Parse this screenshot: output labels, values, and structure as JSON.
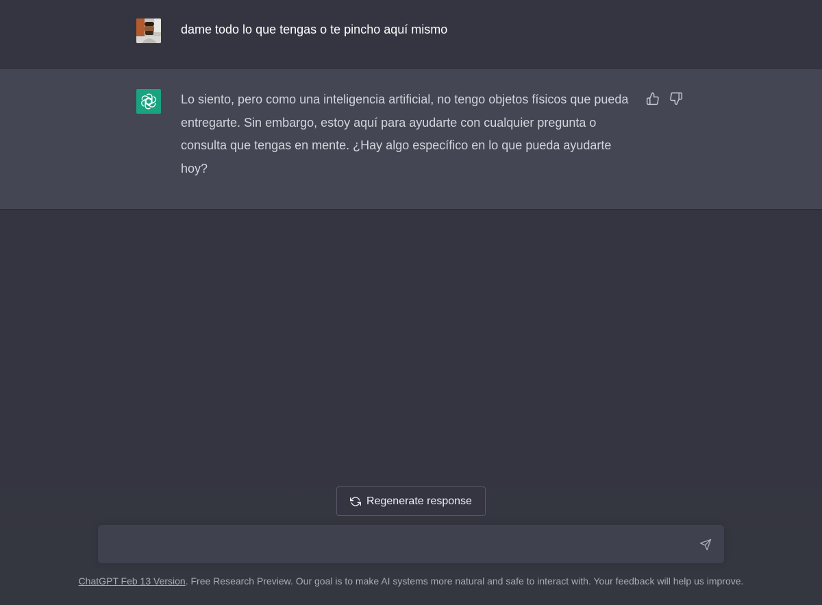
{
  "conversation": {
    "user_message": "dame todo lo que tengas o te pincho aquí mismo",
    "assistant_message": "Lo siento, pero como una inteligencia artificial, no tengo objetos físicos que pueda entregarte. Sin embargo, estoy aquí para ayudarte con cualquier pregunta o consulta que tengas en mente. ¿Hay algo específico en lo que pueda ayudarte hoy?"
  },
  "icons": {
    "user_avatar": "user-avatar-photo",
    "assistant_avatar": "openai-logo-icon",
    "thumbs_up": "thumbs-up-icon",
    "thumbs_down": "thumbs-down-icon",
    "regenerate": "refresh-icon",
    "send": "paper-plane-icon"
  },
  "controls": {
    "regenerate_label": "Regenerate response",
    "input_value": "",
    "input_placeholder": ""
  },
  "footer": {
    "version_link": "ChatGPT Feb 13 Version",
    "text": ". Free Research Preview. Our goal is to make AI systems more natural and safe to interact with. Your feedback will help us improve."
  },
  "colors": {
    "background": "#343541",
    "assistant_row": "#444654",
    "input_bg": "#40414f",
    "accent_green": "#19a37f",
    "text": "#d1d5db"
  }
}
